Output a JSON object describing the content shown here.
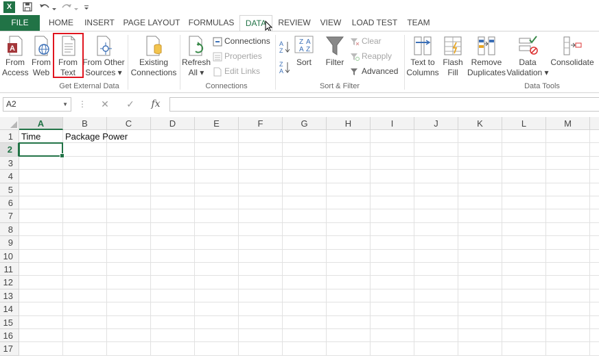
{
  "qat": {
    "logo": "X",
    "icons": [
      "save-icon",
      "undo-icon",
      "redo-icon",
      "customize-icon"
    ]
  },
  "tabs": [
    {
      "name": "file",
      "label": "FILE"
    },
    {
      "name": "home",
      "label": "HOME"
    },
    {
      "name": "insert",
      "label": "INSERT"
    },
    {
      "name": "page-layout",
      "label": "PAGE LAYOUT"
    },
    {
      "name": "formulas",
      "label": "FORMULAS"
    },
    {
      "name": "data",
      "label": "DATA"
    },
    {
      "name": "review",
      "label": "REVIEW"
    },
    {
      "name": "view",
      "label": "VIEW"
    },
    {
      "name": "load-test",
      "label": "LOAD TEST"
    },
    {
      "name": "team",
      "label": "TEAM"
    }
  ],
  "active_tab": "DATA",
  "ribbon": {
    "get_external_data": {
      "label": "Get External Data",
      "from_access": [
        "From",
        "Access"
      ],
      "from_web": [
        "From",
        "Web"
      ],
      "from_text": [
        "From",
        "Text"
      ],
      "from_other_sources": [
        "From Other",
        "Sources ▾"
      ],
      "existing_connections": [
        "Existing",
        "Connections"
      ]
    },
    "connections": {
      "label": "Connections",
      "refresh_all": [
        "Refresh",
        "All ▾"
      ],
      "connections": "Connections",
      "properties": "Properties",
      "edit_links": "Edit Links"
    },
    "sort_filter": {
      "label": "Sort & Filter",
      "sort": "Sort",
      "filter": "Filter",
      "clear": "Clear",
      "reapply": "Reapply",
      "advanced": "Advanced"
    },
    "data_tools": {
      "label": "Data Tools",
      "text_to_columns": [
        "Text to",
        "Columns"
      ],
      "flash_fill": [
        "Flash",
        "Fill"
      ],
      "remove_duplicates": [
        "Remove",
        "Duplicates"
      ],
      "data_validation": [
        "Data",
        "Validation ▾"
      ],
      "consolidate": "Consolidate"
    }
  },
  "formula_bar": {
    "name_box": "A2",
    "fx": "fx",
    "value": ""
  },
  "grid": {
    "columns": [
      "A",
      "B",
      "C",
      "D",
      "E",
      "F",
      "G",
      "H",
      "I",
      "J",
      "K",
      "L",
      "M"
    ],
    "rows": [
      "1",
      "2",
      "3",
      "4",
      "5",
      "6",
      "7",
      "8",
      "9",
      "10",
      "11",
      "12",
      "13",
      "14",
      "15",
      "16",
      "17"
    ],
    "cells": {
      "A1": "Time",
      "B1": "Package Power"
    },
    "selected": "A2"
  },
  "colors": {
    "excel_green": "#217346",
    "highlight_red": "#e0141e"
  }
}
